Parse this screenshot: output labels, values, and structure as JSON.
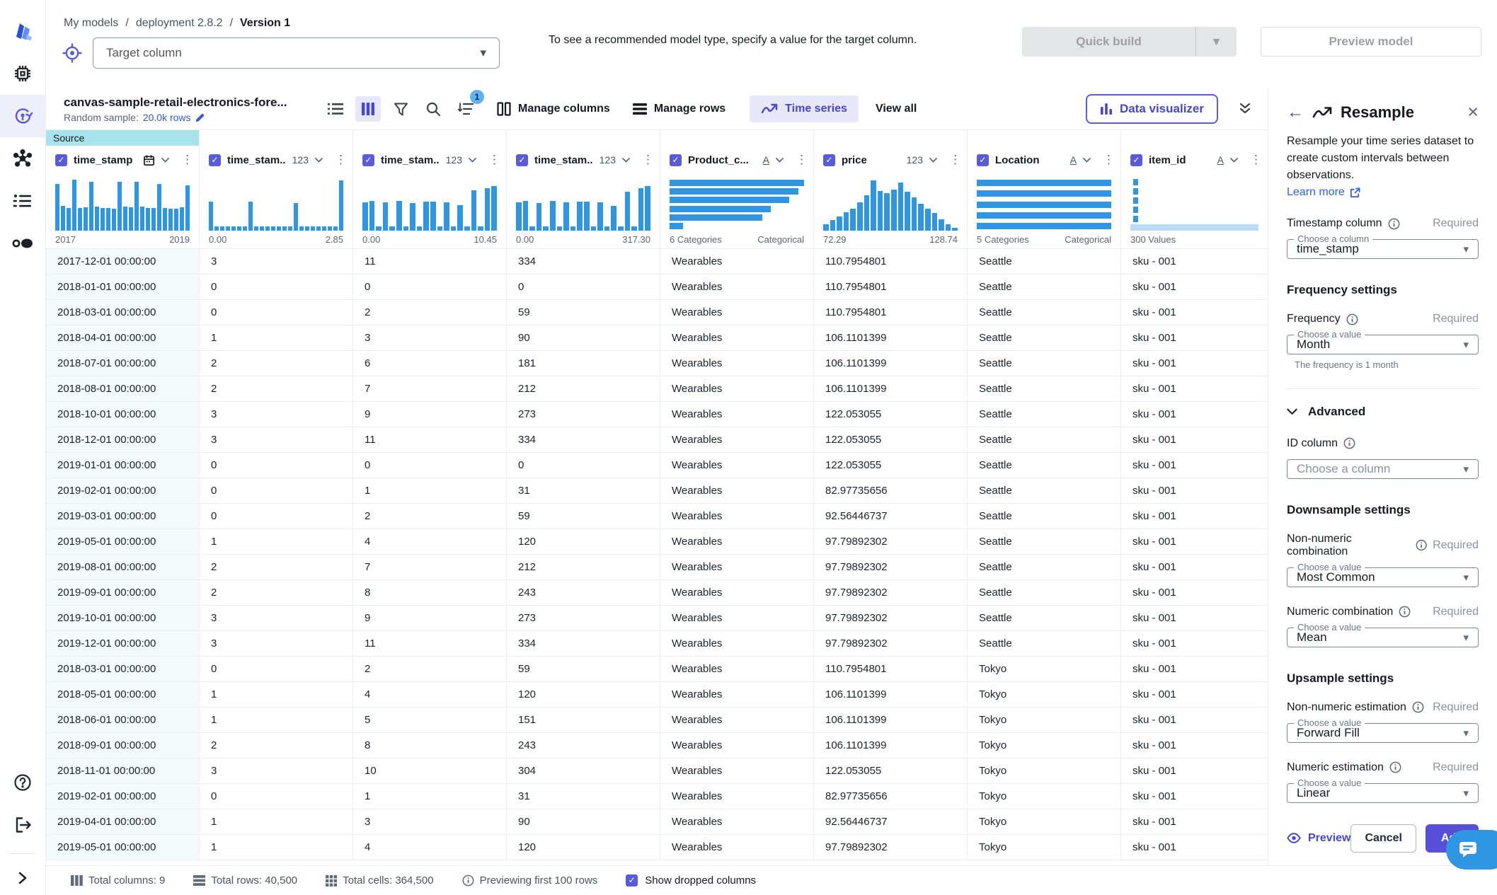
{
  "breadcrumb": {
    "items": [
      "My models",
      "deployment 2.8.2",
      "Version 1"
    ],
    "separator": "/"
  },
  "target": {
    "placeholder": "Target column"
  },
  "hint": "To see a recommended model type, specify a value for the target column.",
  "actions": {
    "quick_build": "Quick build",
    "preview_model": "Preview model"
  },
  "toolbar": {
    "dataset_name": "canvas-sample-retail-electronics-fore...",
    "random_sample_label": "Random sample:",
    "random_sample_value": "20.0k rows",
    "filter_badge": "1",
    "manage_columns": "Manage columns",
    "manage_rows": "Manage rows",
    "time_series": "Time series",
    "view_all": "View all",
    "data_visualizer": "Data visualizer"
  },
  "colors": {
    "accent": "#5a5bd8",
    "histogram": "#2f96e3",
    "histogram_light": "#bcdcf5",
    "source_tab": "#a8e4ec",
    "link": "#2d5ff0"
  },
  "table": {
    "source_tab": "Source",
    "columns": [
      {
        "name": "time_stamp",
        "type": "datetime",
        "hist_type": "vbar",
        "bars": [
          0.9,
          0.48,
          0.44,
          0.98,
          0.44,
          0.45,
          0.95,
          0.46,
          0.44,
          0.44,
          0.42,
          0.95,
          0.46,
          0.45,
          0.94,
          0.46,
          0.44,
          0.44,
          0.91,
          0.44,
          0.43,
          0.42,
          0.45,
          0.88
        ],
        "left_label": "2017",
        "right_label": "2019"
      },
      {
        "name": "time_stam...",
        "type": "123",
        "hist_type": "vbar",
        "bars": [
          0.56,
          0.08,
          0.08,
          0.08,
          0.08,
          0.08,
          0.08,
          0.56,
          0.08,
          0.08,
          0.08,
          0.08,
          0.08,
          0.08,
          0.08,
          0.54,
          0.08,
          0.08,
          0.08,
          0.08,
          0.08,
          0.08,
          0.08,
          0.97
        ],
        "left_label": "0.00",
        "right_label": "2.85"
      },
      {
        "name": "time_stam...",
        "type": "123",
        "hist_type": "vbar",
        "bars": [
          0.55,
          0.57,
          0.08,
          0.55,
          0.08,
          0.57,
          0.08,
          0.54,
          0.08,
          0.56,
          0.56,
          0.08,
          0.55,
          0.08,
          0.5,
          0.08,
          0.78,
          0.08,
          0.82,
          0.86
        ],
        "left_label": "0.00",
        "right_label": "10.45"
      },
      {
        "name": "time_stam...",
        "type": "123",
        "hist_type": "vbar",
        "bars": [
          0.55,
          0.57,
          0.08,
          0.54,
          0.08,
          0.57,
          0.08,
          0.55,
          0.08,
          0.56,
          0.56,
          0.08,
          0.55,
          0.08,
          0.48,
          0.08,
          0.76,
          0.08,
          0.82,
          0.86
        ],
        "left_label": "0.00",
        "right_label": "317.30"
      },
      {
        "name": "Product_c...",
        "type": "A",
        "hist_type": "hbar",
        "bars": [
          1,
          0.96,
          0.89,
          0.75,
          0.69,
          0.1
        ],
        "left_label": "6 Categories",
        "right_label": "Categorical"
      },
      {
        "name": "price",
        "type": "123",
        "hist_type": "vbar",
        "bars": [
          0.12,
          0.2,
          0.28,
          0.35,
          0.43,
          0.55,
          0.68,
          0.97,
          0.77,
          0.72,
          0.8,
          0.93,
          0.75,
          0.65,
          0.52,
          0.43,
          0.34,
          0.22,
          0.13,
          0.05
        ],
        "left_label": "72.29",
        "right_label": "128.74"
      },
      {
        "name": "Location",
        "type": "A",
        "hist_type": "hbar",
        "bars": [
          1,
          1,
          1,
          1,
          1
        ],
        "left_label": "5 Categories",
        "right_label": "Categorical"
      },
      {
        "name": "item_id",
        "type": "A",
        "hist_type": "dashed",
        "bars": [],
        "left_label": "300 Values",
        "right_label": ""
      }
    ],
    "rows": [
      [
        "2017-12-01 00:00:00",
        "3",
        "11",
        "334",
        "Wearables",
        "110.7954801",
        "Seattle",
        "sku - 001"
      ],
      [
        "2018-01-01 00:00:00",
        "0",
        "0",
        "0",
        "Wearables",
        "110.7954801",
        "Seattle",
        "sku - 001"
      ],
      [
        "2018-03-01 00:00:00",
        "0",
        "2",
        "59",
        "Wearables",
        "110.7954801",
        "Seattle",
        "sku - 001"
      ],
      [
        "2018-04-01 00:00:00",
        "1",
        "3",
        "90",
        "Wearables",
        "106.1101399",
        "Seattle",
        "sku - 001"
      ],
      [
        "2018-07-01 00:00:00",
        "2",
        "6",
        "181",
        "Wearables",
        "106.1101399",
        "Seattle",
        "sku - 001"
      ],
      [
        "2018-08-01 00:00:00",
        "2",
        "7",
        "212",
        "Wearables",
        "106.1101399",
        "Seattle",
        "sku - 001"
      ],
      [
        "2018-10-01 00:00:00",
        "3",
        "9",
        "273",
        "Wearables",
        "122.053055",
        "Seattle",
        "sku - 001"
      ],
      [
        "2018-12-01 00:00:00",
        "3",
        "11",
        "334",
        "Wearables",
        "122.053055",
        "Seattle",
        "sku - 001"
      ],
      [
        "2019-01-01 00:00:00",
        "0",
        "0",
        "0",
        "Wearables",
        "122.053055",
        "Seattle",
        "sku - 001"
      ],
      [
        "2019-02-01 00:00:00",
        "0",
        "1",
        "31",
        "Wearables",
        "82.97735656",
        "Seattle",
        "sku - 001"
      ],
      [
        "2019-03-01 00:00:00",
        "0",
        "2",
        "59",
        "Wearables",
        "92.56446737",
        "Seattle",
        "sku - 001"
      ],
      [
        "2019-05-01 00:00:00",
        "1",
        "4",
        "120",
        "Wearables",
        "97.79892302",
        "Seattle",
        "sku - 001"
      ],
      [
        "2019-08-01 00:00:00",
        "2",
        "7",
        "212",
        "Wearables",
        "97.79892302",
        "Seattle",
        "sku - 001"
      ],
      [
        "2019-09-01 00:00:00",
        "2",
        "8",
        "243",
        "Wearables",
        "97.79892302",
        "Seattle",
        "sku - 001"
      ],
      [
        "2019-10-01 00:00:00",
        "3",
        "9",
        "273",
        "Wearables",
        "97.79892302",
        "Seattle",
        "sku - 001"
      ],
      [
        "2019-12-01 00:00:00",
        "3",
        "11",
        "334",
        "Wearables",
        "97.79892302",
        "Seattle",
        "sku - 001"
      ],
      [
        "2018-03-01 00:00:00",
        "0",
        "2",
        "59",
        "Wearables",
        "110.7954801",
        "Tokyo",
        "sku - 001"
      ],
      [
        "2018-05-01 00:00:00",
        "1",
        "4",
        "120",
        "Wearables",
        "106.1101399",
        "Tokyo",
        "sku - 001"
      ],
      [
        "2018-06-01 00:00:00",
        "1",
        "5",
        "151",
        "Wearables",
        "106.1101399",
        "Tokyo",
        "sku - 001"
      ],
      [
        "2018-09-01 00:00:00",
        "2",
        "8",
        "243",
        "Wearables",
        "106.1101399",
        "Tokyo",
        "sku - 001"
      ],
      [
        "2018-11-01 00:00:00",
        "3",
        "10",
        "304",
        "Wearables",
        "122.053055",
        "Tokyo",
        "sku - 001"
      ],
      [
        "2019-02-01 00:00:00",
        "0",
        "1",
        "31",
        "Wearables",
        "82.97735656",
        "Tokyo",
        "sku - 001"
      ],
      [
        "2019-04-01 00:00:00",
        "1",
        "3",
        "90",
        "Wearables",
        "92.56446737",
        "Tokyo",
        "sku - 001"
      ],
      [
        "2019-05-01 00:00:00",
        "1",
        "4",
        "120",
        "Wearables",
        "97.79892302",
        "Tokyo",
        "sku - 001"
      ]
    ]
  },
  "panel": {
    "title": "Resample",
    "description": "Resample your time series dataset to create custom intervals between observations.",
    "learn_more": "Learn more",
    "required": "Required",
    "timestamp": {
      "label": "Timestamp column",
      "float": "Choose a column",
      "value": "time_stamp"
    },
    "frequency_settings": "Frequency settings",
    "frequency": {
      "label": "Frequency",
      "float": "Choose a value",
      "value": "Month",
      "helper": "The frequency is 1 month"
    },
    "advanced": "Advanced",
    "id_column": {
      "label": "ID column",
      "placeholder": "Choose a column"
    },
    "downsample_settings": "Downsample settings",
    "non_numeric_combination": {
      "label": "Non-numeric combination",
      "float": "Choose a value",
      "value": "Most Common"
    },
    "numeric_combination": {
      "label": "Numeric combination",
      "float": "Choose a value",
      "value": "Mean"
    },
    "upsample_settings": "Upsample settings",
    "non_numeric_estimation": {
      "label": "Non-numeric estimation",
      "float": "Choose a value",
      "value": "Forward Fill"
    },
    "numeric_estimation": {
      "label": "Numeric estimation",
      "float": "Choose a value",
      "value": "Linear"
    },
    "preview": "Preview",
    "cancel": "Cancel",
    "add": "Add"
  },
  "statusbar": {
    "total_columns": "Total columns: 9",
    "total_rows": "Total rows: 40,500",
    "total_cells": "Total cells: 364,500",
    "previewing": "Previewing first 100 rows",
    "show_dropped": "Show dropped columns"
  }
}
